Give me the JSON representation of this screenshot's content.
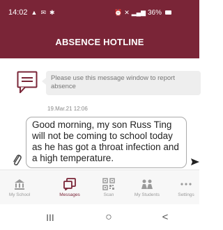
{
  "status_bar": {
    "time": "14:02",
    "battery": "36%",
    "left_icons": [
      "notification-icon",
      "mail-icon",
      "app-icon"
    ],
    "right_icons": [
      "alarm-icon",
      "mute-icon",
      "signal-icon"
    ]
  },
  "header": {
    "title": "ABSENCE HOTLINE"
  },
  "chat": {
    "incoming_message": "Please use this message window to report absence",
    "timestamp": "19.Mar.21 12:06",
    "draft_message": "Good morning, my son Russ Ting will not be coming to school today as he has got a throat infection and a high temperature."
  },
  "bottom_nav": [
    {
      "label": "My School",
      "icon": "school-icon",
      "active": false
    },
    {
      "label": "Messages",
      "icon": "messages-icon",
      "active": true
    },
    {
      "label": "Scan",
      "icon": "qr-icon",
      "active": false
    },
    {
      "label": "My Students",
      "icon": "students-icon",
      "active": false
    },
    {
      "label": "Settings",
      "icon": "more-icon",
      "active": false
    }
  ],
  "system_nav": {
    "recents": "III",
    "home": "○",
    "back": "<"
  },
  "colors": {
    "brand": "#7a2537",
    "inactive": "#9a9a9a"
  }
}
